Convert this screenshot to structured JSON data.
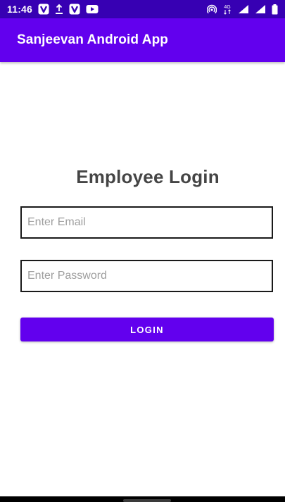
{
  "status_bar": {
    "time": "11:46",
    "left_icons": [
      "v-app-icon",
      "upload-icon",
      "v-app-icon",
      "youtube-icon"
    ],
    "right_icons": [
      "hotspot-icon",
      "data-4g-icon",
      "signal-icon",
      "signal-icon",
      "battery-icon"
    ],
    "network_label": "4G"
  },
  "app_bar": {
    "title": "Sanjeevan Android App"
  },
  "login": {
    "title": "Employee Login",
    "email_placeholder": "Enter Email",
    "password_placeholder": "Enter Password",
    "button_label": "LOGIN"
  },
  "colors": {
    "status_bar": "#3700b3",
    "primary": "#6200ee",
    "title_text": "#454545",
    "placeholder_text": "#9e9e9e",
    "field_border": "#1a1a1a"
  }
}
